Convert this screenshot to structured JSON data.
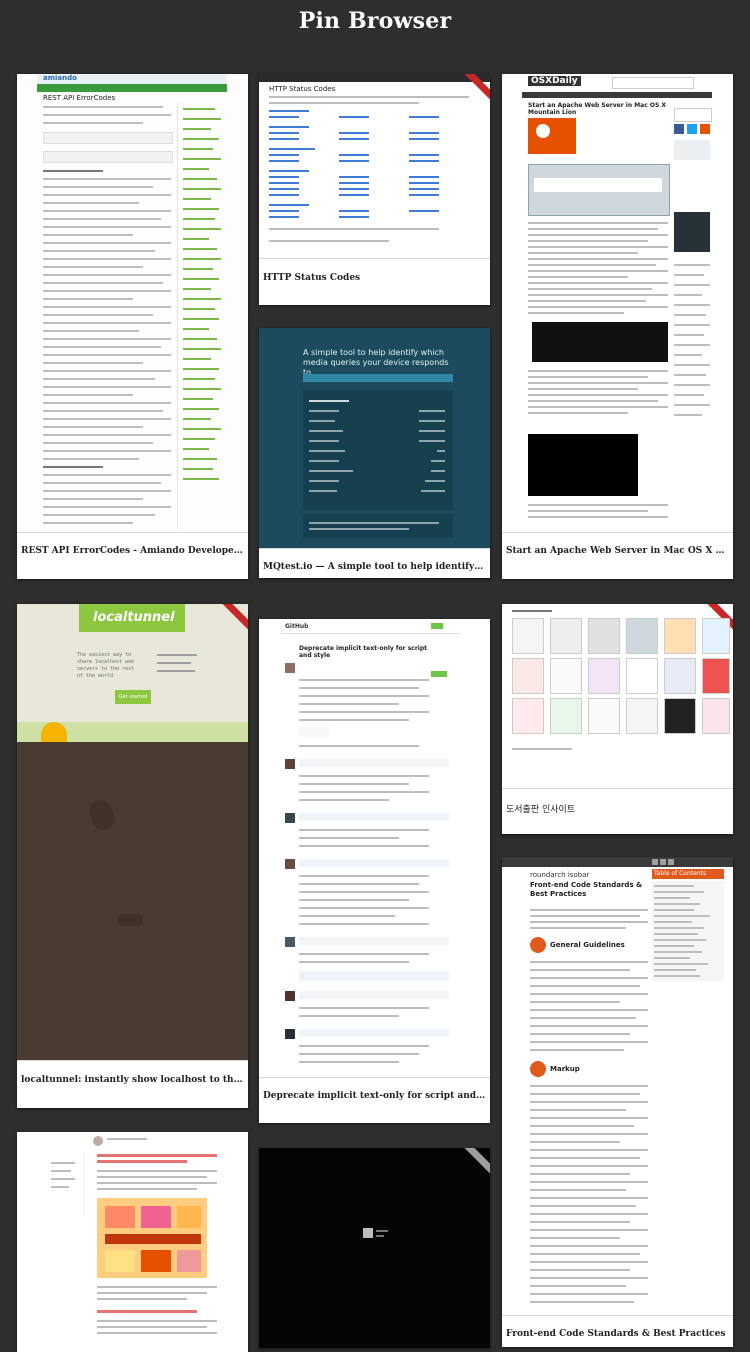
{
  "header": {
    "title": "Pin Browser"
  },
  "pins": [
    {
      "caption": "REST API ErrorCodes - Amiando Developer Wiki"
    },
    {
      "caption": "HTTP Status Codes"
    },
    {
      "caption": "Start an Apache Web Server in Mac OS X Mountai…"
    },
    {
      "caption": "MQtest.io — A simple tool to help identify which …"
    },
    {
      "caption": "localtunnel: instantly show localhost to the rest of…"
    },
    {
      "caption": "Deprecate implicit text-only for script and style by…"
    },
    {
      "caption": "도서출판 인사이트"
    },
    {
      "caption": "Front-end Code Standards & Best Practices"
    }
  ],
  "thumb_text": {
    "amiando_logo": "amiando",
    "amiando_heading": "REST API ErrorCodes",
    "http_heading": "HTTP Status Codes",
    "osx_logo": "OSXDaily",
    "osx_heading": "Start an Apache Web Server in Mac OS X Mountain Lion",
    "mq_heading": "A simple tool to help identify which media queries your device responds to.",
    "lt_logo": "localtunnel",
    "lt_tagline": "The easiest way to share localhost web servers to the rest of the world",
    "lt_button": "Get started",
    "gh_heading": "Deprecate implicit text-only for script and style",
    "insight_heading": "도서출판 인사이트",
    "razorfish_logo": "roundarch isobar",
    "razorfish_heading": "Front-end Code Standards & Best Practices",
    "razorfish_guidelines": "General Guidelines",
    "razorfish_markup": "Markup",
    "razorfish_toc": "Table of Contents"
  },
  "colors": {
    "page_bg": "#2e2e2e",
    "card_bg": "#ffffff",
    "ribbon": "#c62828",
    "mq_bg": "#1c4b5e",
    "lt_green": "#8dc63f",
    "lt_brown": "#4a3b31",
    "razorfish_orange": "#e05a1e"
  }
}
